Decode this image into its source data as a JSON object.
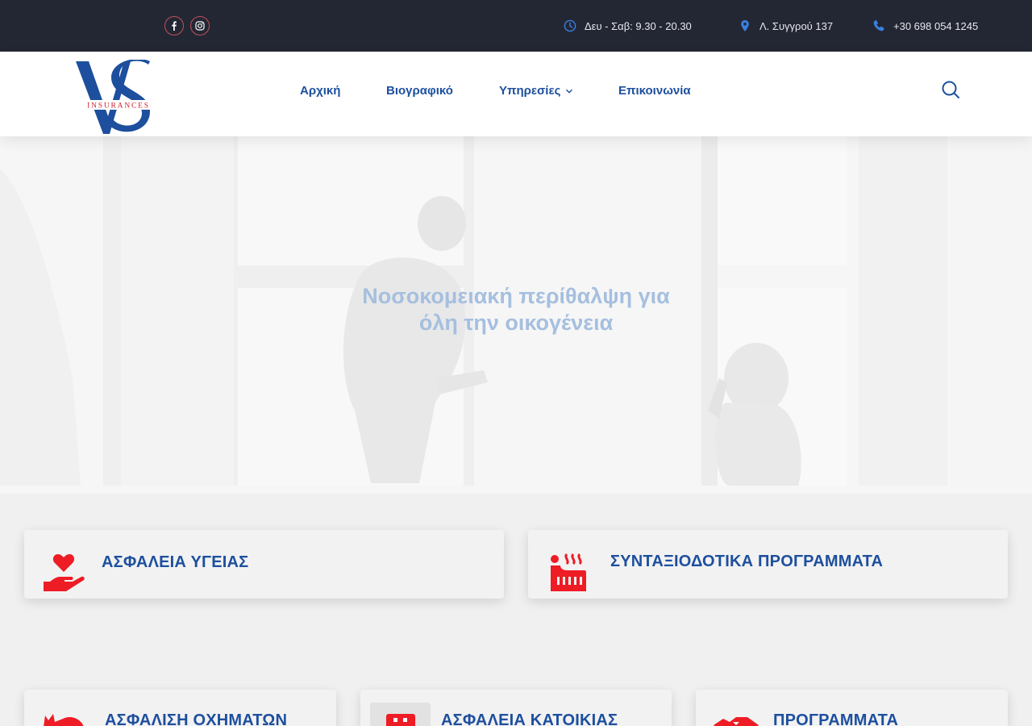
{
  "topbar": {
    "social": [
      {
        "name": "facebook-icon"
      },
      {
        "name": "instagram-icon"
      }
    ],
    "hours": "Δευ - Σαβ: 9.30 - 20.30",
    "address": "Λ. Συγγρού 137",
    "phone": "+30 698 054 1245"
  },
  "header": {
    "logo_text": "INSURANCES",
    "nav": [
      {
        "label": "Αρχική"
      },
      {
        "label": "Βιογραφικό"
      },
      {
        "label": "Υπηρεσίες"
      },
      {
        "label": "Επικοινωνία"
      }
    ]
  },
  "hero": {
    "title_line1": "Νοσοκομειακή περίθαλψη για",
    "title_line2": "όλη την οικογένεια"
  },
  "services": [
    {
      "title": "ΑΣΦΑΛΕΙΑ ΥΓΕΙΑΣ",
      "icon": "heart-hand-icon"
    },
    {
      "title": "ΣΥΝΤΑΞΙΟΔΟΤΙΚΑ ΠΡΟΓΡΑΜΜΑΤΑ",
      "icon": "pension-icon"
    },
    {
      "title": "ΑΣΦΑΛΙΣΗ ΟΧΗΜΑΤΩΝ",
      "icon": "car-icon"
    },
    {
      "title": "ΑΣΦΑΛΕΙΑ ΚΑΤΟΙΚΙΑΣ",
      "icon": "house-icon"
    },
    {
      "title": "ΠΡΟΓΡΑΜΜΑΤΑ",
      "icon": "handshake-icon"
    }
  ],
  "colors": {
    "topbar_bg": "#232733",
    "brand_blue": "#1d4f9e",
    "icon_red": "#ee1c25",
    "hero_text": "#a5bfdf"
  }
}
